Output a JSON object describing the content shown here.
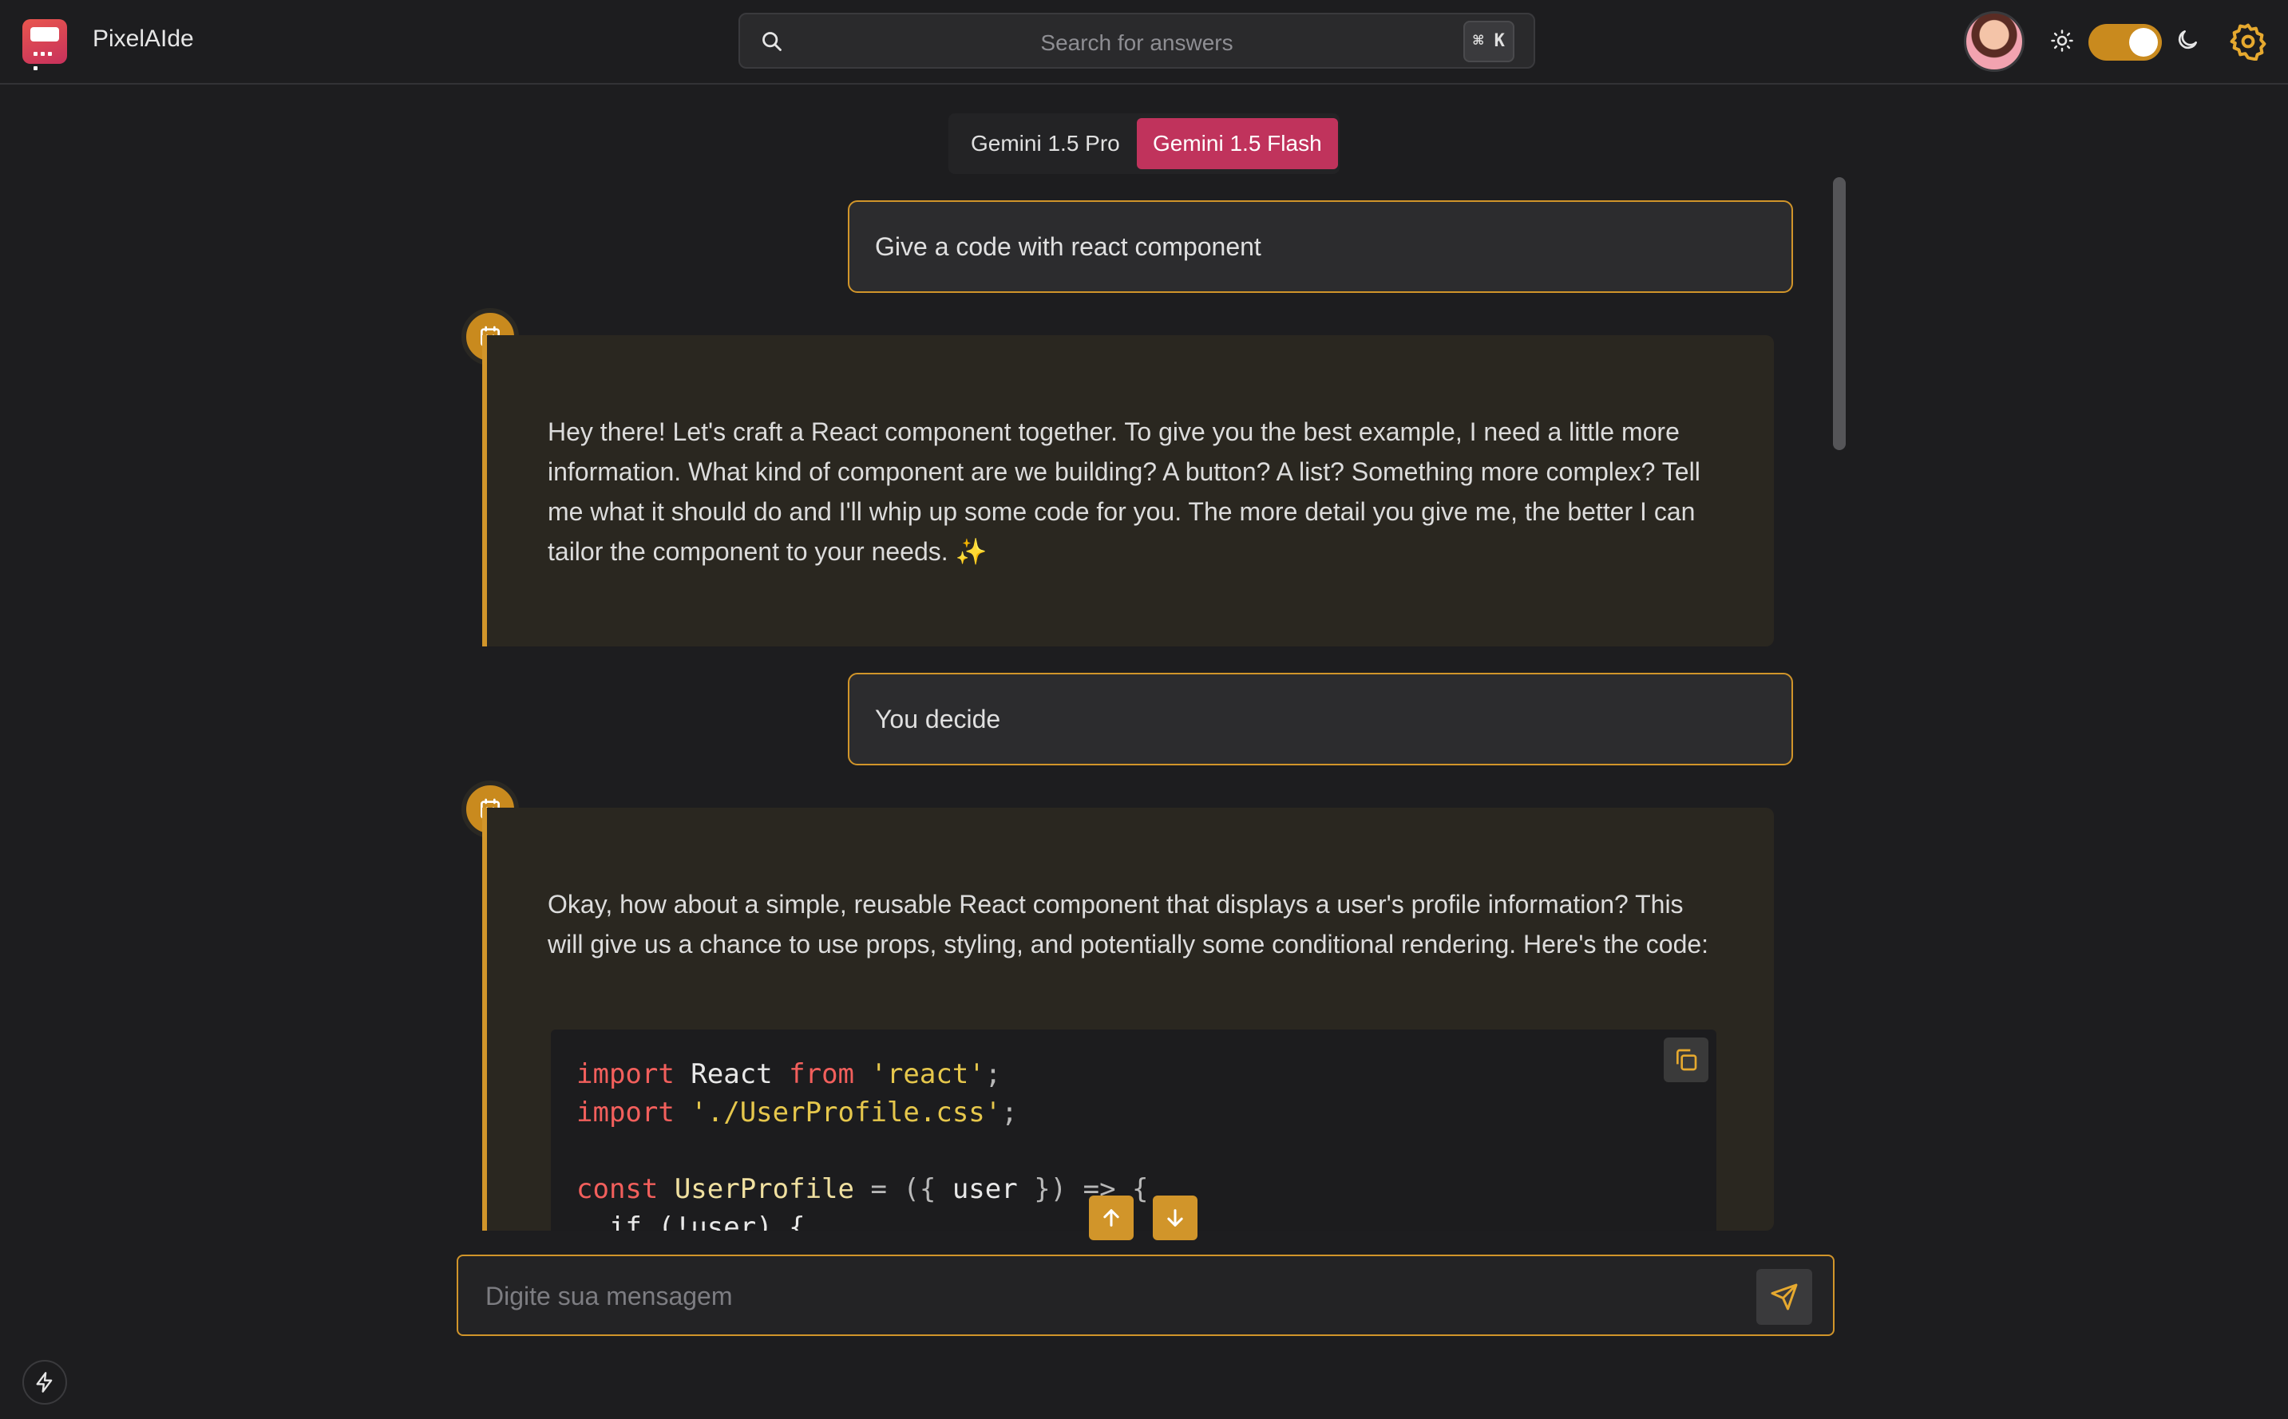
{
  "header": {
    "app_name": "PixelAIde",
    "search": {
      "placeholder": "Search for answers",
      "shortcut": "⌘ K"
    },
    "theme_toggle": {
      "state": "on"
    },
    "icons": [
      "logo-icon",
      "search-icon",
      "avatar",
      "sun-icon",
      "moon-icon",
      "gear-icon"
    ]
  },
  "model_switch": {
    "options": [
      "Gemini 1.5 Pro",
      "Gemini 1.5 Flash"
    ],
    "selected": "Gemini 1.5 Flash"
  },
  "conversation": [
    {
      "role": "user",
      "text": "Give a code with react component"
    },
    {
      "role": "assistant",
      "text": "Hey there! Let's craft a React component together. To give you the best example, I need a little more information. What kind of component are we building? A button? A list? Something more complex? Tell me what it should do and I'll whip up some code for you. The more detail you give me, the better I can tailor the component to your needs. ✨"
    },
    {
      "role": "user",
      "text": "You decide"
    },
    {
      "role": "assistant",
      "text": "Okay, how about a simple, reusable React component that displays a user's profile information? This will give us a chance to use props, styling, and potentially some conditional rendering. Here's the code:",
      "code": {
        "line1_kw": "import",
        "line1_id": " React ",
        "line1_kw2": "from",
        "line1_str": " 'react'",
        "line1_end": ";",
        "line2_kw": "import",
        "line2_str": " './UserProfile.css'",
        "line2_end": ";",
        "line3_kw": "const",
        "line3_id": " UserProfile ",
        "line3_rest": "= ({ ",
        "line3_user": "user",
        "line3_end": " }) => {",
        "line4": "  if (!user) {"
      }
    }
  ],
  "composer": {
    "placeholder": "Digite sua mensagem"
  },
  "colors": {
    "accent": "#d1952a",
    "flash": "#c0335c",
    "background": "#1d1d1f"
  }
}
